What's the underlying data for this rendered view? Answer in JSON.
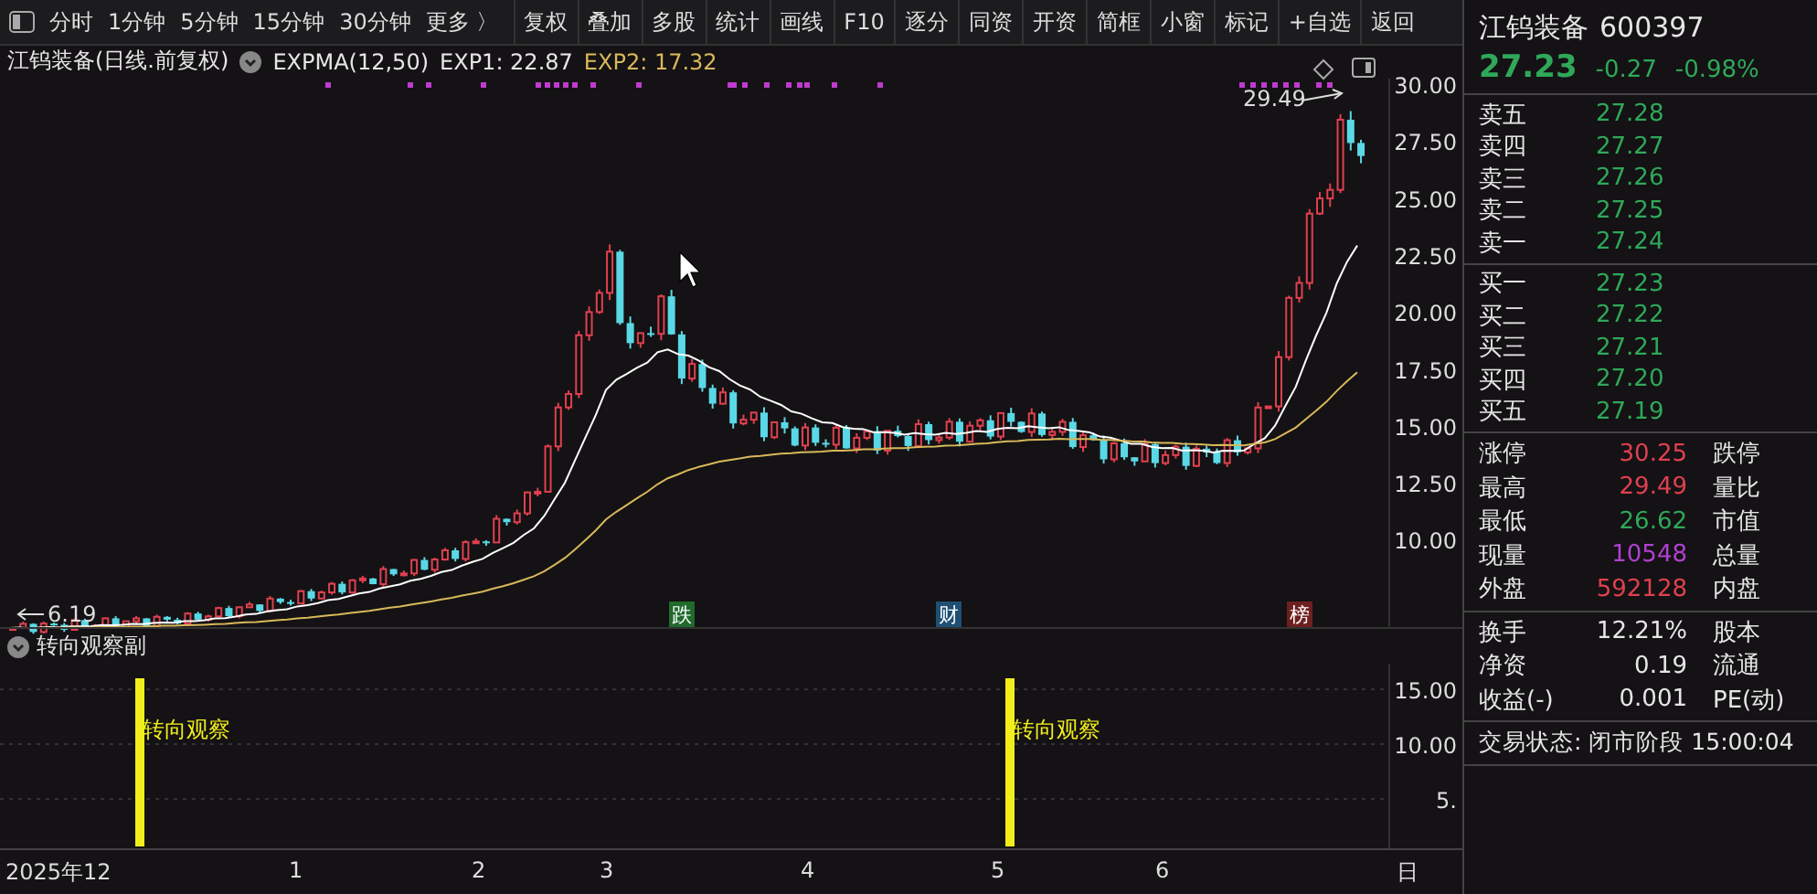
{
  "toolbar": {
    "periods": [
      "分时",
      "1分钟",
      "5分钟",
      "15分钟",
      "30分钟",
      "更多 〉"
    ],
    "buttons": [
      "复权",
      "叠加",
      "多股",
      "统计",
      "画线",
      "F10",
      "逐分",
      "同资",
      "开资",
      "简框",
      "小窗",
      "标记",
      "+自选",
      "返回"
    ]
  },
  "chart": {
    "title": "江钨装备(日线.前复权)",
    "indicator": "EXPMA(12,50)",
    "exp1": "EXP1: 22.87",
    "exp2": "EXP2: 17.32",
    "y_labels": [
      "30.00",
      "27.50",
      "25.00",
      "22.50",
      "20.00",
      "17.50",
      "15.00",
      "12.50",
      "10.00"
    ],
    "high_label": "29.49",
    "low_label": "6.19",
    "event_tags": [
      {
        "text": "跌",
        "color": "#1f6a2c"
      },
      {
        "text": "财",
        "color": "#1f4f73"
      },
      {
        "text": "榜",
        "color": "#6e1f1f"
      }
    ]
  },
  "indicator_panel": {
    "title": "转向观察副",
    "signals": [
      {
        "label": "转向观察"
      },
      {
        "label": "转向观察"
      }
    ],
    "y_labels": [
      "15.00",
      "10.00",
      "5."
    ]
  },
  "x_axis": [
    "2025年12",
    "1",
    "2",
    "3",
    "4",
    "5",
    "6",
    "日"
  ],
  "quote": {
    "name": "江钨装备",
    "code": "600397",
    "price": "27.23",
    "change": "-0.27",
    "change_pct": "-0.98%",
    "asks": [
      {
        "label": "卖五",
        "price": "27.28"
      },
      {
        "label": "卖四",
        "price": "27.27"
      },
      {
        "label": "卖三",
        "price": "27.26"
      },
      {
        "label": "卖二",
        "price": "27.25"
      },
      {
        "label": "卖一",
        "price": "27.24"
      }
    ],
    "bids": [
      {
        "label": "买一",
        "price": "27.23"
      },
      {
        "label": "买二",
        "price": "27.22"
      },
      {
        "label": "买三",
        "price": "27.21"
      },
      {
        "label": "买四",
        "price": "27.20"
      },
      {
        "label": "买五",
        "price": "27.19"
      }
    ],
    "stats": [
      {
        "label": "涨停",
        "value": "30.25",
        "color": "#e0404f",
        "label2": "跌停"
      },
      {
        "label": "最高",
        "value": "29.49",
        "color": "#e0404f",
        "label2": "量比"
      },
      {
        "label": "最低",
        "value": "26.62",
        "color": "#2fa85a",
        "label2": "市值"
      },
      {
        "label": "现量",
        "value": "10548",
        "color": "#b040d0",
        "label2": "总量"
      },
      {
        "label": "外盘",
        "value": "592128",
        "color": "#e0404f",
        "label2": "内盘"
      }
    ],
    "fundamentals": [
      {
        "label": "换手",
        "value": "12.21%",
        "label2": "股本"
      },
      {
        "label": "净资",
        "value": "0.19",
        "label2": "流通"
      },
      {
        "label": "收益(-)",
        "value": "0.001",
        "label2": "PE(动)"
      }
    ],
    "status": "交易状态: 闭市阶段 15:00:04"
  }
}
